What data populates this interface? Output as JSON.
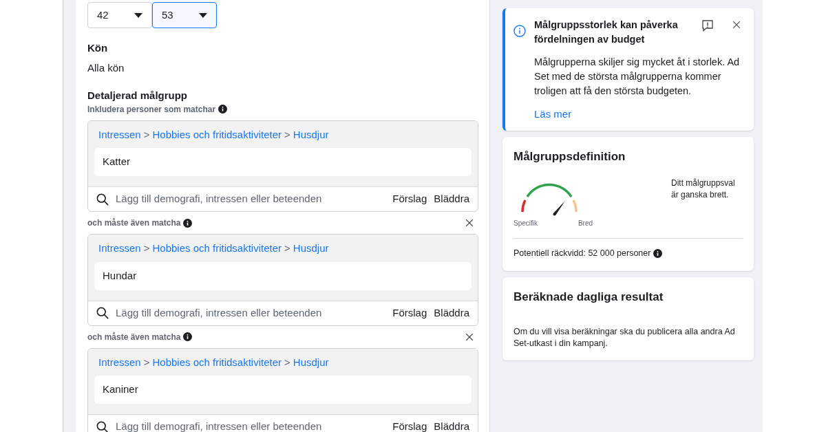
{
  "age_selects": [
    {
      "value": "42",
      "focused": false
    },
    {
      "value": "53",
      "focused": true
    }
  ],
  "gender": {
    "label": "Kön",
    "value": "Alla kön"
  },
  "detailed": {
    "title": "Detaljerad målgrupp",
    "groups": [
      {
        "label": "Inkludera personer som matchar",
        "removable": false,
        "breadcrumb": [
          "Intressen",
          "Hobbies och fritidsaktiviteter",
          "Husdjur"
        ],
        "separator": ">",
        "item": "Katter",
        "search_placeholder": "Lägg till demografi, intressen eller beteenden",
        "actions": [
          "Förslag",
          "Bläddra"
        ]
      },
      {
        "label": "och måste även matcha",
        "removable": true,
        "breadcrumb": [
          "Intressen",
          "Hobbies och fritidsaktiviteter",
          "Husdjur"
        ],
        "separator": ">",
        "item": "Hundar",
        "search_placeholder": "Lägg till demografi, intressen eller beteenden",
        "actions": [
          "Förslag",
          "Bläddra"
        ]
      },
      {
        "label": "och måste även matcha",
        "removable": true,
        "breadcrumb": [
          "Intressen",
          "Hobbies och fritidsaktiviteter",
          "Husdjur"
        ],
        "separator": ">",
        "item": "Kaniner",
        "search_placeholder": "Lägg till demografi, intressen eller beteenden",
        "actions": [
          "Förslag",
          "Bläddra"
        ]
      }
    ]
  },
  "notice": {
    "title": "Målgruppsstorlek kan påverka fördelningen av budget",
    "body": "Målgrupperna skiljer sig mycket åt i storlek. Ad Set med de största målgrupperna kommer troligen att få den största budgeten.",
    "link": "Läs mer"
  },
  "definition": {
    "title": "Målgruppsdefinition",
    "gauge_left": "Specifik",
    "gauge_right": "Bred",
    "summary": "Ditt målgruppsval är ganska brett.",
    "reach": "Potentiell räckvidd: 52 000 personer"
  },
  "estimates": {
    "title": "Beräknade dagliga resultat",
    "body": "Om du vill visa beräkningar ska du publicera alla andra Ad Set-utkast i din kampanj."
  }
}
